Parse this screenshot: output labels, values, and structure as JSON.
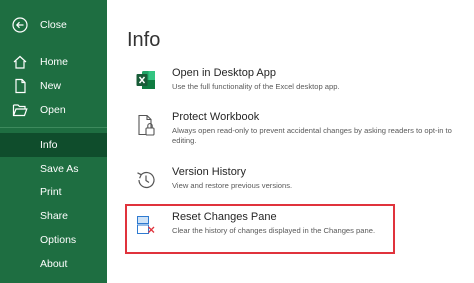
{
  "sidebar": {
    "close": "Close",
    "home": "Home",
    "new": "New",
    "open": "Open",
    "info": "Info",
    "save_as": "Save As",
    "print": "Print",
    "share": "Share",
    "options": "Options",
    "about": "About"
  },
  "main": {
    "title": "Info",
    "items": [
      {
        "title": "Open in Desktop App",
        "desc": "Use the full functionality of the Excel desktop app.",
        "icon": "excel-icon"
      },
      {
        "title": "Protect Workbook",
        "desc": "Always open read-only to prevent accidental changes by asking readers to opt-in to editing.",
        "icon": "lock-document-icon"
      },
      {
        "title": "Version History",
        "desc": "View and restore previous versions.",
        "icon": "history-icon"
      },
      {
        "title": "Reset Changes Pane",
        "desc": "Clear the history of changes displayed in the Changes pane.",
        "icon": "reset-pane-icon"
      }
    ]
  },
  "colors": {
    "sidebar": "#1e6e41",
    "active": "#0f4d2c",
    "highlight": "#e0333c"
  }
}
